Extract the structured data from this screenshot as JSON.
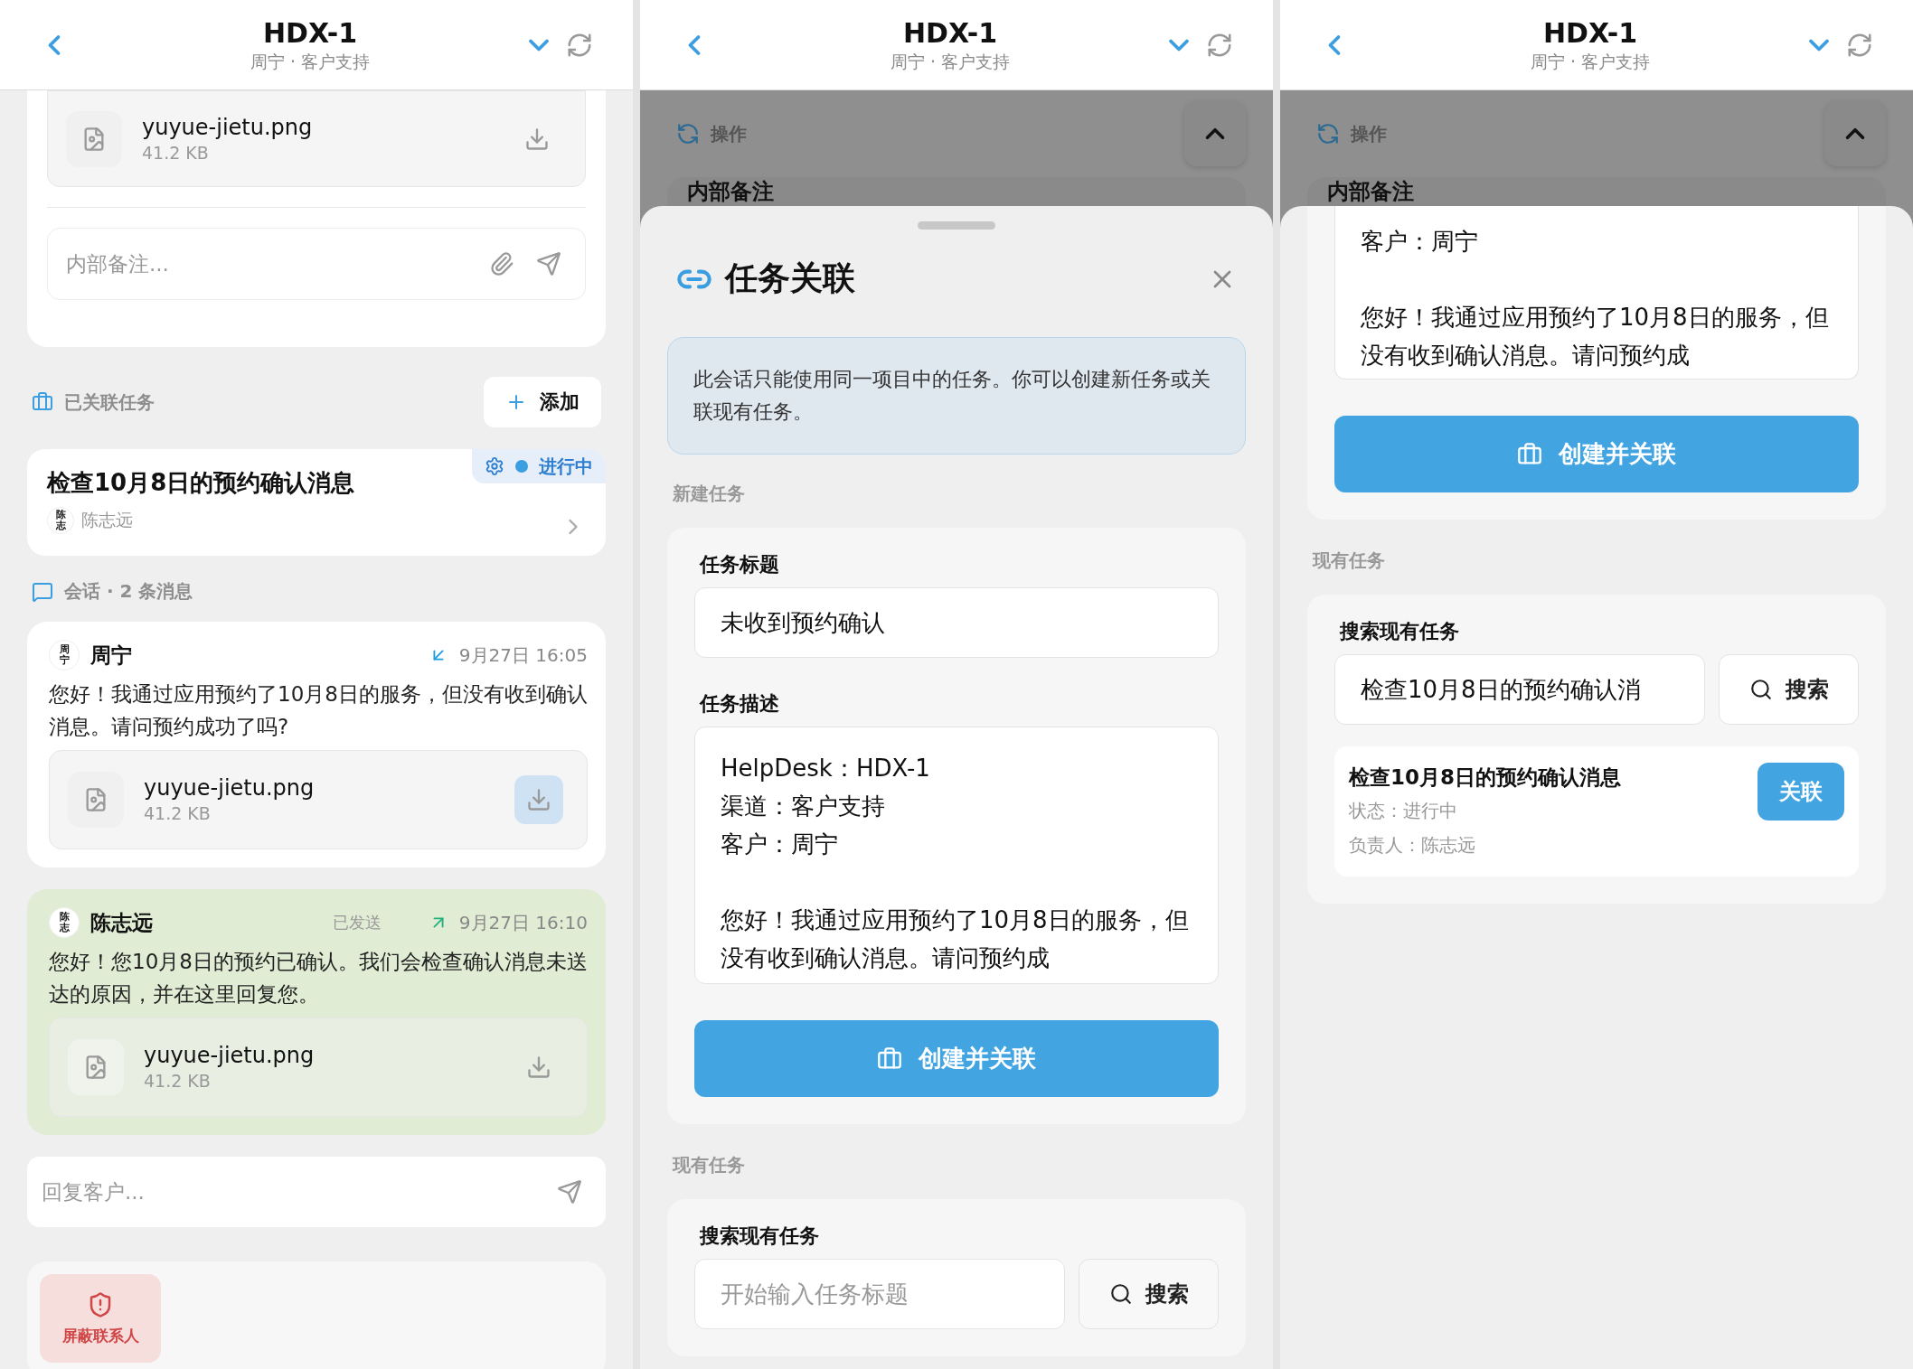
{
  "left_panel": {
    "header": {
      "title": "HDX-1",
      "subtitle": "周宁 · 客户支持"
    },
    "top_card": {
      "attachment": {
        "name": "yuyue-jietu.png",
        "size": "41.2 KB",
        "highlighted": false
      },
      "note_field": {
        "placeholder": "内部备注..."
      }
    },
    "linked_tasks": {
      "title": "已关联任务",
      "add_button": "添加",
      "tasks": [
        {
          "title": "检查10月8日的预约确认消息",
          "status": "进行中",
          "assignee": "陈志远",
          "avatar_text": "陈志"
        }
      ]
    },
    "conversation": {
      "title": "会话 · 2 条消息",
      "messages": [
        {
          "kind": "incoming",
          "sender": "周宁",
          "avatar_text": "周宁",
          "time": "9月27日 16:05",
          "text": "您好！我通过应用预约了10月8日的服务，但没有收到确认消息。请问预约成功了吗?",
          "attachment": {
            "name": "yuyue-jietu.png",
            "size": "41.2 KB",
            "highlighted": true
          }
        },
        {
          "kind": "outgoing",
          "sender": "陈志远",
          "avatar_text": "陈志",
          "status": "已发送",
          "time": "9月27日 16:10",
          "text": "您好！您10月8日的预约已确认。我们会检查确认消息未送达的原因，并在这里回复您。",
          "attachment": {
            "name": "yuyue-jietu.png",
            "size": "41.2 KB",
            "highlighted": false
          }
        }
      ]
    },
    "reply_field": {
      "placeholder": "回复客户..."
    },
    "actions": [
      {
        "kind": "danger",
        "label": "屏蔽联系人"
      }
    ]
  },
  "middle_panel": {
    "header": {
      "title": "HDX-1",
      "subtitle": "周宁 · 客户支持"
    },
    "background": {
      "section_title": "操作",
      "note_heading": "内部备注"
    },
    "sheet": {
      "title": "任务关联",
      "info": "此会话只能使用同一项目中的任务。你可以创建新任务或关联现有任务。",
      "new_task": {
        "section_title": "新建任务",
        "title_label": "任务标题",
        "title_value": "未收到预约确认",
        "description_label": "任务描述",
        "description_paragraphs": [
          [
            "HelpDesk：HDX-1",
            "渠道：客户支持",
            "客户：周宁"
          ],
          [
            "您好！我通过应用预约了10月8日的服务，但没有收到确认消息。请问预约成"
          ]
        ],
        "submit_button": "创建并关联"
      },
      "existing": {
        "section_title": "现有任务",
        "search_label": "搜索现有任务",
        "search_placeholder": "开始输入任务标题",
        "search_button": "搜索"
      }
    }
  },
  "right_panel": {
    "header": {
      "title": "HDX-1",
      "subtitle": "周宁 · 客户支持"
    },
    "background": {
      "section_title": "操作",
      "note_heading": "内部备注"
    },
    "sheet": {
      "new_task": {
        "description_paragraphs": [
          [
            "客户：周宁"
          ],
          [
            "您好！我通过应用预约了10月8日的服务，但没有收到确认消息。请问预约成"
          ]
        ],
        "submit_button": "创建并关联"
      },
      "existing": {
        "section_title": "现有任务",
        "search_label": "搜索现有任务",
        "search_value": "检查10月8日的预约确认消",
        "search_button": "搜索",
        "results": [
          {
            "title": "检查10月8日的预约确认消息",
            "status": "状态：进行中",
            "assignee": "负责人：陈志远",
            "link_button": "关联"
          }
        ]
      }
    }
  }
}
